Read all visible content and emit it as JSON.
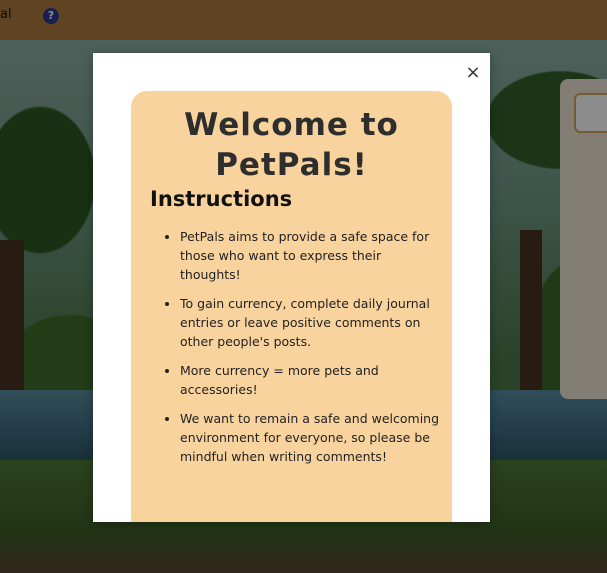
{
  "nav": {
    "left_text": "al",
    "help_icon": "?"
  },
  "modal": {
    "close_label": "×",
    "title": "Welcome to PetPals!",
    "subtitle": "Instructions",
    "instructions": [
      "PetPals aims to provide a safe space for those who want to express their thoughts!",
      "To gain currency, complete daily journal entries or leave positive comments on other people's posts.",
      "More currency = more pets and accessories!",
      "We want to remain a safe and welcoming environment for everyone, so please be mindful when writing comments!"
    ]
  },
  "colors": {
    "topbar": "#b07a3e",
    "card": "#f8d39e",
    "help_icon": "#2b3a8f"
  }
}
